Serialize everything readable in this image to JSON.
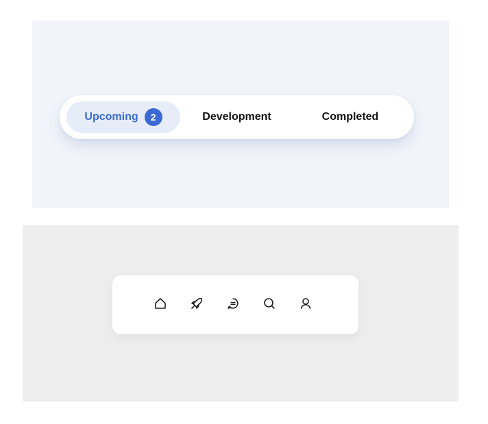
{
  "tabs": {
    "items": [
      {
        "label": "Upcoming",
        "badge": "2",
        "active": true
      },
      {
        "label": "Development",
        "active": false
      },
      {
        "label": "Completed",
        "active": false
      }
    ]
  },
  "bottom_nav": {
    "icons": [
      "home-icon",
      "rocket-icon",
      "chat-icon",
      "search-icon",
      "user-icon"
    ]
  },
  "colors": {
    "accent": "#3b69d3",
    "active_tab_bg": "#e6edf9",
    "top_panel_bg": "#f1f4fa",
    "bottom_panel_bg": "#ededed"
  }
}
